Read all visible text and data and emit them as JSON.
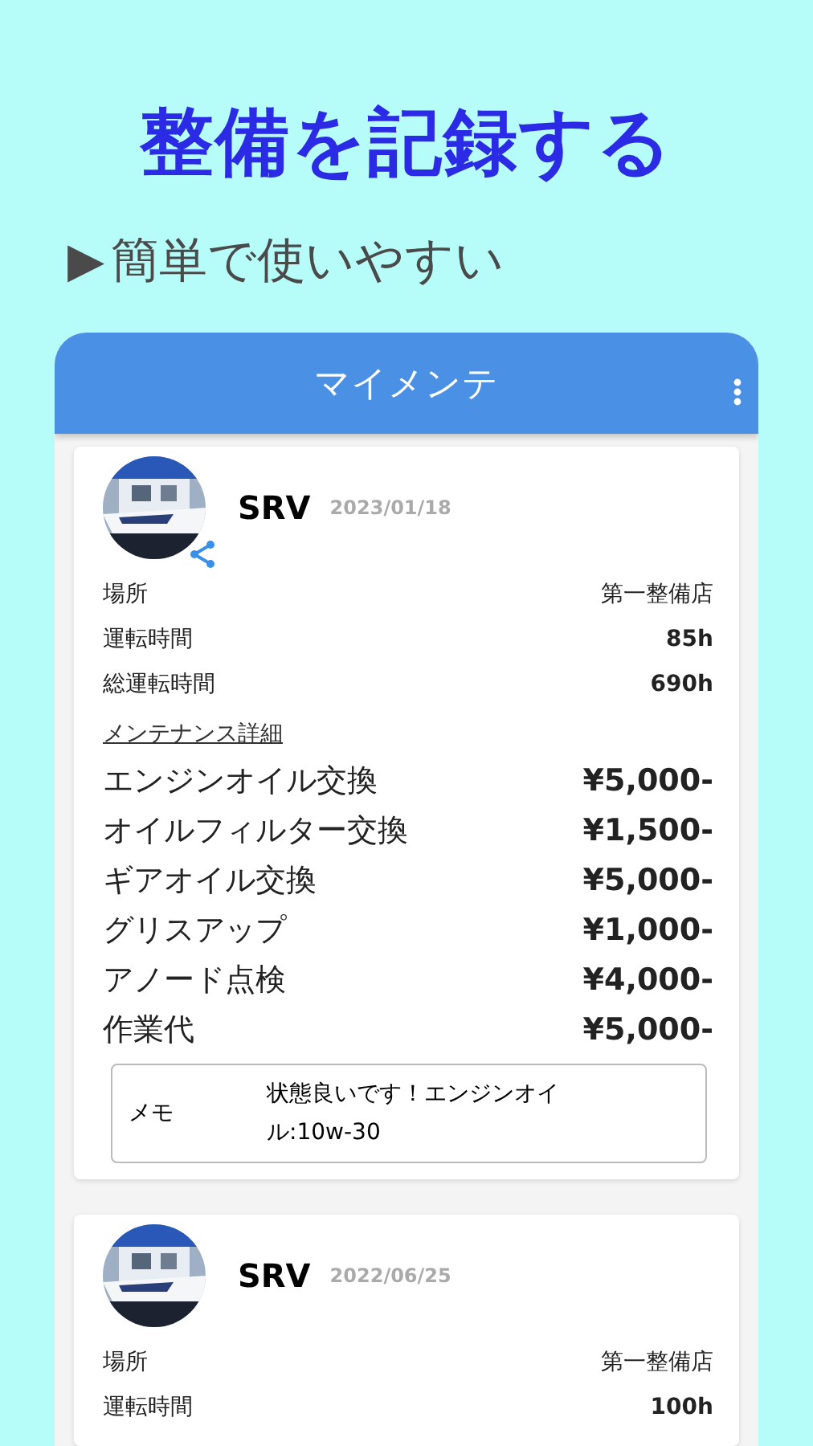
{
  "headline": "整備を記録する",
  "subtitle": {
    "marker": "▶",
    "text": "簡単で使いやすい"
  },
  "app": {
    "title": "マイメンテ"
  },
  "records": [
    {
      "name": "SRV",
      "date": "2023/01/18",
      "shared": true,
      "fields": [
        {
          "label": "場所",
          "value": "第一整備店"
        },
        {
          "label": "運転時間",
          "value": "85h"
        },
        {
          "label": "総運転時間",
          "value": "690h"
        }
      ],
      "details_label": "メンテナンス詳細",
      "items": [
        {
          "label": "エンジンオイル交換",
          "price": "¥5,000-"
        },
        {
          "label": "オイルフィルター交換",
          "price": "¥1,500-"
        },
        {
          "label": "ギアオイル交換",
          "price": "¥5,000-"
        },
        {
          "label": "グリスアップ",
          "price": "¥1,000-"
        },
        {
          "label": "アノード点検",
          "price": "¥4,000-"
        },
        {
          "label": "作業代",
          "price": "¥5,000-"
        }
      ],
      "memo": {
        "label": "メモ",
        "text": "状態良いです！エンジンオイル:10w-30"
      }
    },
    {
      "name": "SRV",
      "date": "2022/06/25",
      "shared": false,
      "fields": [
        {
          "label": "場所",
          "value": "第一整備店"
        },
        {
          "label": "運転時間",
          "value": "100h"
        }
      ]
    }
  ]
}
